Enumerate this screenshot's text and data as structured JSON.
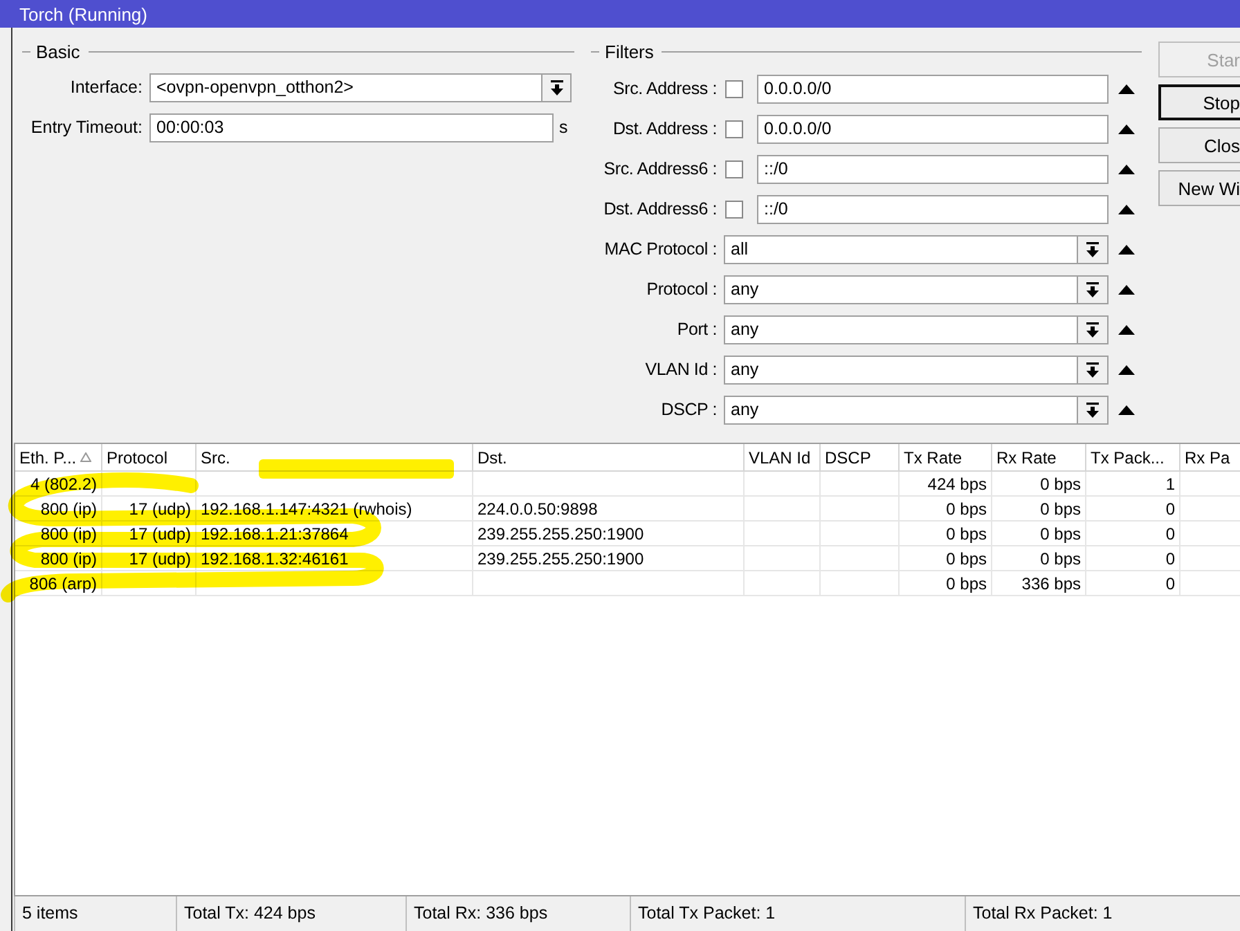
{
  "window": {
    "title": "Torch (Running)"
  },
  "basic": {
    "title": "Basic",
    "fields": [
      {
        "kind": "dropdown",
        "label": "Interface:",
        "value": "<ovpn-openvpn_otthon2>"
      },
      {
        "kind": "text",
        "label": "Entry Timeout:",
        "value": "00:00:03",
        "unit": "s"
      }
    ]
  },
  "filters": {
    "title": "Filters",
    "fields": [
      {
        "kind": "address",
        "label": "Src. Address :",
        "checked": false,
        "value": "0.0.0.0/0"
      },
      {
        "kind": "address",
        "label": "Dst. Address :",
        "checked": false,
        "value": "0.0.0.0/0"
      },
      {
        "kind": "address",
        "label": "Src. Address6 :",
        "checked": false,
        "value": "::/0"
      },
      {
        "kind": "address",
        "label": "Dst. Address6 :",
        "checked": false,
        "value": "::/0"
      },
      {
        "kind": "dropdown",
        "label": "MAC Protocol :",
        "value": "all"
      },
      {
        "kind": "dropdown",
        "label": "Protocol :",
        "value": "any"
      },
      {
        "kind": "dropdown",
        "label": "Port :",
        "value": "any"
      },
      {
        "kind": "dropdown",
        "label": "VLAN Id :",
        "value": "any"
      },
      {
        "kind": "dropdown",
        "label": "DSCP :",
        "value": "any"
      }
    ]
  },
  "buttons": [
    {
      "label": "Star",
      "disabled": true,
      "default": false
    },
    {
      "label": "Stop",
      "disabled": false,
      "default": true
    },
    {
      "label": "Clos",
      "disabled": false,
      "default": false
    },
    {
      "label": "New Wi",
      "disabled": false,
      "default": false
    }
  ],
  "table": {
    "columns": [
      {
        "label": "Eth. P...",
        "sorted": true
      },
      {
        "label": "Protocol",
        "sorted": false
      },
      {
        "label": "Src.",
        "sorted": false
      },
      {
        "label": "Dst.",
        "sorted": false
      },
      {
        "label": "VLAN Id",
        "sorted": false
      },
      {
        "label": "DSCP",
        "sorted": false
      },
      {
        "label": "Tx Rate",
        "sorted": false
      },
      {
        "label": "Rx Rate",
        "sorted": false
      },
      {
        "label": "Tx Pack...",
        "sorted": false
      },
      {
        "label": "Rx Pa",
        "sorted": false
      }
    ],
    "rows": [
      {
        "selected": false,
        "cells": [
          "4 (802.2)",
          null,
          null,
          null,
          null,
          null,
          "424 bps",
          "0 bps",
          "1",
          null
        ]
      },
      {
        "selected": false,
        "cells": [
          "800 (ip)",
          "17 (udp)",
          "192.168.1.147:4321 (rwhois)",
          "224.0.0.50:9898",
          null,
          null,
          "0 bps",
          "0 bps",
          "0",
          null
        ]
      },
      {
        "selected": false,
        "cells": [
          "800 (ip)",
          "17 (udp)",
          "192.168.1.21:37864",
          "239.255.255.250:1900",
          null,
          null,
          "0 bps",
          "0 bps",
          "0",
          null
        ]
      },
      {
        "selected": false,
        "cells": [
          "800 (ip)",
          "17 (udp)",
          "192.168.1.32:46161",
          "239.255.255.250:1900",
          null,
          null,
          "0 bps",
          "0 bps",
          "0",
          null
        ]
      },
      {
        "selected": false,
        "cells": [
          "806 (arp)",
          null,
          null,
          null,
          null,
          null,
          "0 bps",
          "336 bps",
          "0",
          null
        ]
      }
    ]
  },
  "status_bar": [
    "5 items",
    "Total Tx: 424 bps",
    "Total Rx: 336 bps",
    "Total Tx Packet: 1",
    "Total Rx Packet: 1"
  ]
}
